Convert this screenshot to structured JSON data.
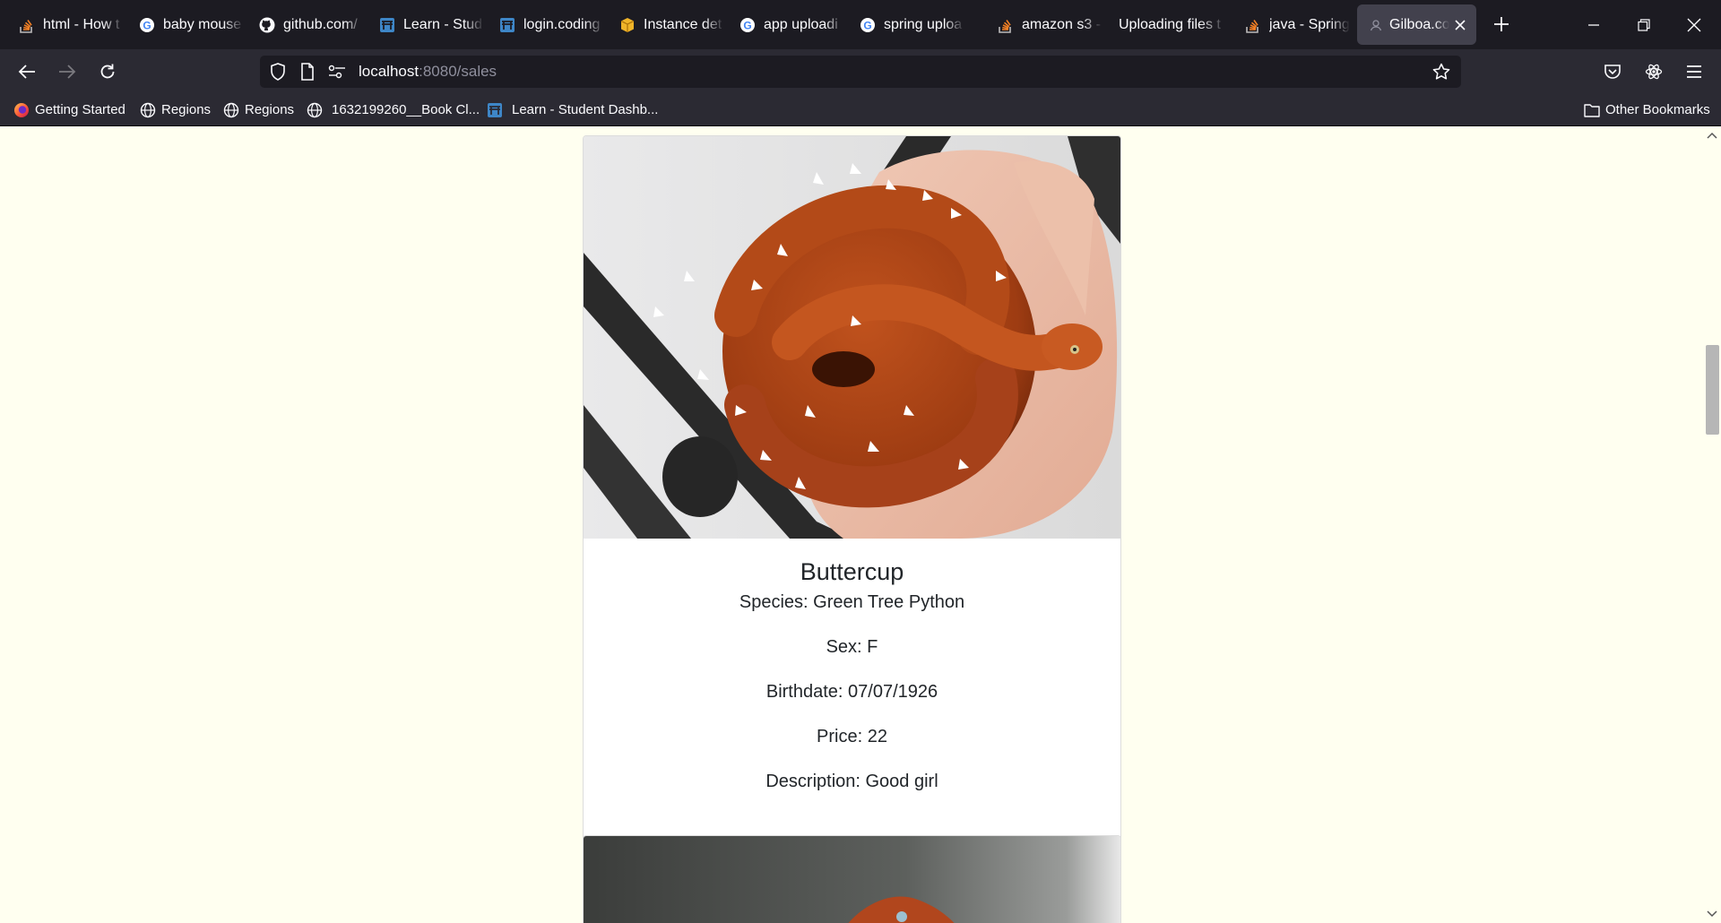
{
  "browser": {
    "tabs": [
      {
        "label": "html - How t",
        "icon": "stackoverflow-icon"
      },
      {
        "label": "baby mouse",
        "icon": "google-icon"
      },
      {
        "label": "github.com/",
        "icon": "github-icon"
      },
      {
        "label": "Learn - Stud",
        "icon": "codingdojo-icon"
      },
      {
        "label": "login.coding",
        "icon": "codingdojo-icon"
      },
      {
        "label": "Instance det",
        "icon": "aws-box-icon"
      },
      {
        "label": "app uploadi",
        "icon": "google-icon"
      },
      {
        "label": "spring uploa",
        "icon": "google-icon"
      },
      {
        "label": "amazon s3 -",
        "icon": "stackoverflow-icon"
      },
      {
        "label": "Uploading files t",
        "icon": ""
      },
      {
        "label": "java - Spring",
        "icon": "stackoverflow-icon"
      },
      {
        "label": "Gilboa.co",
        "icon": "page-icon",
        "active": true
      }
    ],
    "url": {
      "host": "localhost",
      "path": ":8080/sales"
    },
    "bookmarks": [
      {
        "label": "Getting Started",
        "icon": "firefox-icon"
      },
      {
        "label": "Regions",
        "icon": "globe-icon"
      },
      {
        "label": "Regions",
        "icon": "globe-icon"
      },
      {
        "label": "1632199260__Book Cl...",
        "icon": "globe-icon"
      },
      {
        "label": "Learn - Student Dashb...",
        "icon": "codingdojo-icon"
      }
    ],
    "other_bookmarks": "Other Bookmarks",
    "colors": {
      "accent_orange": "#f48024",
      "active_tab": "#42414d",
      "page_bg": "#fffff0"
    }
  },
  "listing": {
    "name": "Buttercup",
    "species": "Species: Green Tree Python",
    "sex": "Sex: F",
    "birthdate": "Birthdate: 07/07/1926",
    "price": "Price: 22",
    "description": "Description: Good girl"
  }
}
